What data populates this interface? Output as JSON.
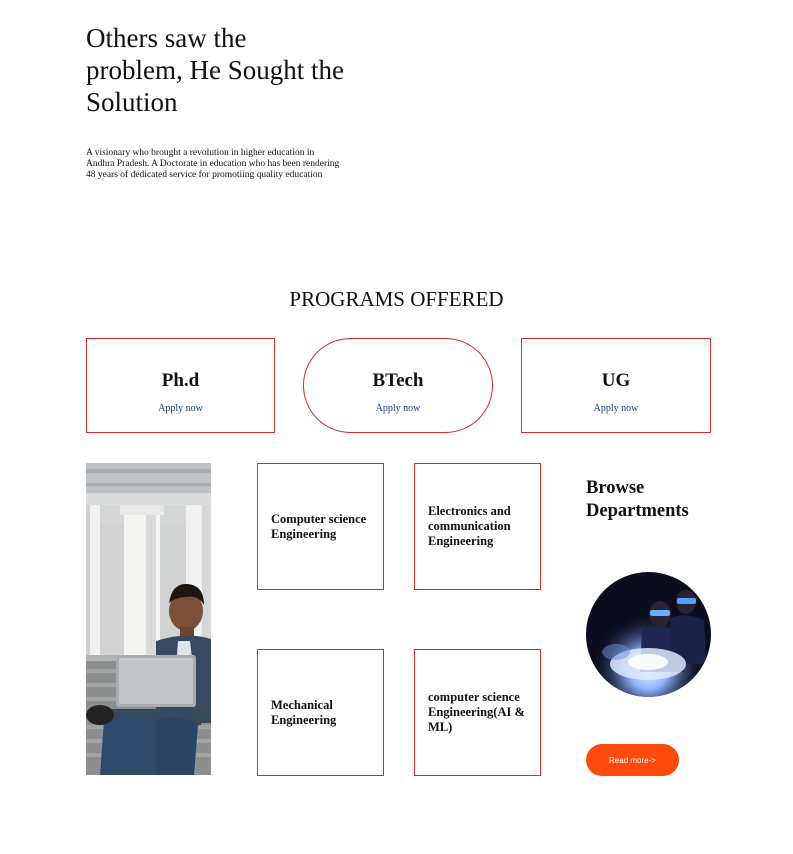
{
  "hero": {
    "title": "Others saw the problem, He Sought the Solution",
    "description": "A visionary who brought a revolution in higher education in Andhra Pradesh. A Doctorate in education who has been rendering 48 years of dedicated service for promotiing quality education"
  },
  "programs": {
    "heading": "PROGRAMS OFFERED",
    "items": [
      {
        "name": "Ph.d",
        "link": "Apply now"
      },
      {
        "name": "BTech",
        "link": "Apply now"
      },
      {
        "name": "UG",
        "link": "Apply now"
      }
    ]
  },
  "departments": {
    "title": "Browse Departments",
    "items": [
      "Computer science Engineering",
      "Electronics and communication Engineering",
      "Mechanical Engineering",
      "computer science Engineering(AI & ML)"
    ],
    "read_more": "Read more->"
  },
  "colors": {
    "card_border": "#d42a2a",
    "link": "#1a3a8a",
    "button": "#ff4a0d"
  }
}
